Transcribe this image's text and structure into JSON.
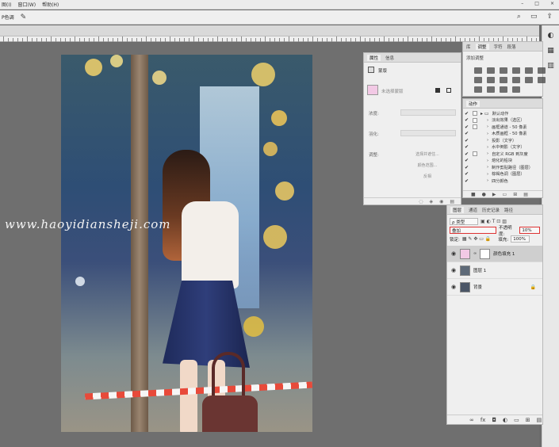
{
  "menu": {
    "items": [
      "图(I)",
      "窗口(W)",
      "帮助(H)"
    ]
  },
  "window_controls": {
    "minimize": "–",
    "maximize": "□",
    "close": "×"
  },
  "options": {
    "left_label": "P色调",
    "search_icon": "⌕",
    "workspace_icon": "▭",
    "share_icon": "⇪"
  },
  "watermark": {
    "text": "www.haoyidiansheji.com"
  },
  "properties": {
    "tabs": [
      "属性",
      "信息"
    ],
    "section": "蒙版",
    "mask_label": "未选择蒙版",
    "density_label": "浓度:",
    "feather_label": "羽化:",
    "refine_label": "调整:",
    "select_subject": "选择并遮住...",
    "color_range": "颜色范围...",
    "invert": "反相"
  },
  "adjust": {
    "tabs": [
      "库",
      "调整",
      "字符",
      "段落"
    ],
    "title": "添加调整"
  },
  "actions": {
    "tab": "动作",
    "items": [
      {
        "label": "默认动作",
        "checked": true,
        "dialog": true,
        "folder": true
      },
      {
        "label": "淡出效果（选区）",
        "checked": true,
        "dialog": true
      },
      {
        "label": "画框通道 - 50 像素",
        "checked": true,
        "dialog": true
      },
      {
        "label": "木质画框 - 50 像素",
        "checked": true,
        "dialog": false
      },
      {
        "label": "投影（文字）",
        "checked": true,
        "dialog": false
      },
      {
        "label": "水中倒影（文字）",
        "checked": true,
        "dialog": false
      },
      {
        "label": "自定义 RGB 到灰度",
        "checked": true,
        "dialog": true
      },
      {
        "label": "熔化的铅块",
        "checked": true,
        "dialog": false
      },
      {
        "label": "制作剪贴路径（图层）",
        "checked": true,
        "dialog": false
      },
      {
        "label": "棕褐色调（图层）",
        "checked": true,
        "dialog": false
      },
      {
        "label": "四分颜色",
        "checked": true,
        "dialog": false
      }
    ]
  },
  "layers": {
    "tabs": [
      "图层",
      "通道",
      "历史记录",
      "路径"
    ],
    "filter_label": "ρ 类型",
    "blend_mode": "叠加",
    "opacity_label": "不透明度:",
    "opacity_value": "10%",
    "lock_label": "锁定:",
    "fill_label": "填充:",
    "fill_value": "100%",
    "list": [
      {
        "name": "颜色填充 1",
        "active": true,
        "thumb_color": "#f2c9e5"
      },
      {
        "name": "图层 1",
        "active": false,
        "thumb_color": "#5e6a78"
      },
      {
        "name": "背景",
        "active": false,
        "thumb_color": "#4a5566",
        "locked": true
      }
    ]
  },
  "colors": {
    "fill_swatch": "#f2c9e5",
    "highlight_red": "#dd3333",
    "canvas_bg": "#6f6f6f"
  }
}
